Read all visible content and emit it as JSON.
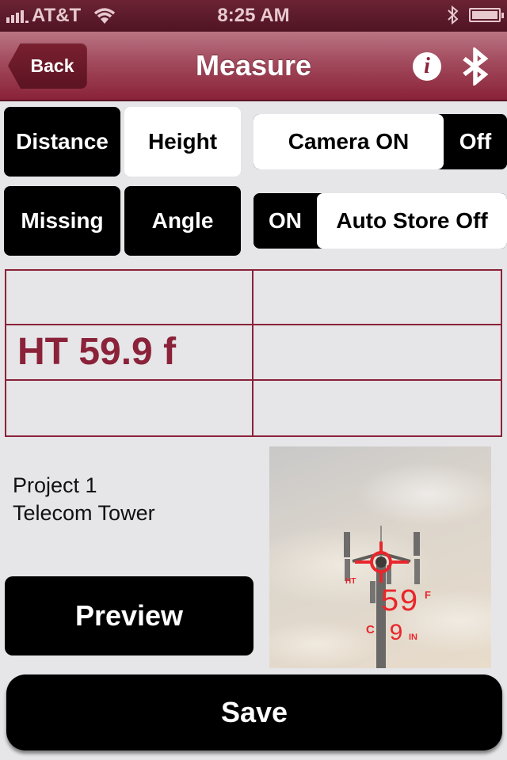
{
  "status_bar": {
    "carrier": "AT&T",
    "time": "8:25 AM",
    "icons": [
      "signal-icon",
      "wifi-icon",
      "bluetooth-icon",
      "battery-icon"
    ]
  },
  "nav": {
    "back_label": "Back",
    "title": "Measure",
    "info_icon_glyph": "i",
    "icons": [
      "info-icon",
      "bluetooth-icon"
    ]
  },
  "modes": {
    "distance": "Distance",
    "height": "Height",
    "missing": "Missing",
    "angle": "Angle",
    "selected": "Height"
  },
  "camera_toggle": {
    "on_label": "Camera ON",
    "off_label": "Off",
    "state": "on"
  },
  "autostore_toggle": {
    "on_label": "ON",
    "off_label": "Auto Store Off",
    "state": "off"
  },
  "readings": {
    "cells": [
      "",
      "",
      "HT 59.9 f",
      "",
      "",
      ""
    ]
  },
  "project": {
    "name": "Project 1",
    "description": "Telecom Tower"
  },
  "photo_overlay": {
    "mode_label": "HT",
    "feet_value": "59",
    "feet_unit": "F",
    "c_label": "C",
    "inch_value": "9",
    "inch_unit": "IN"
  },
  "buttons": {
    "preview": "Preview",
    "save": "Save"
  },
  "colors": {
    "accent": "#8a2239",
    "overlay_red": "#e8262b"
  }
}
